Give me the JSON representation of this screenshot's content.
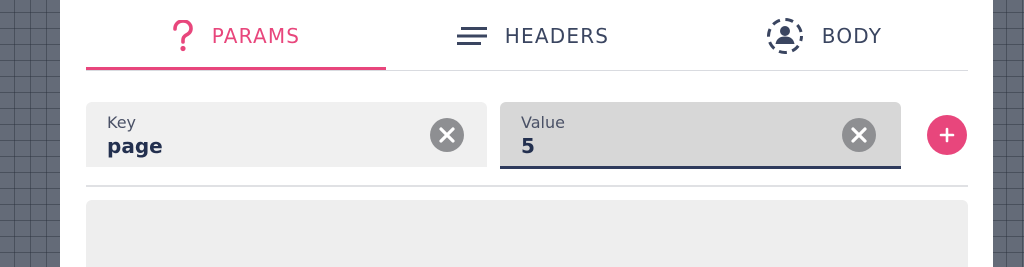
{
  "tabs": [
    {
      "label": "PARAMS",
      "icon": "question-icon",
      "active": true
    },
    {
      "label": "HEADERS",
      "icon": "lines-icon",
      "active": false
    },
    {
      "label": "BODY",
      "icon": "user-circle-icon",
      "active": false
    }
  ],
  "params": {
    "key": {
      "label": "Key",
      "value": "page"
    },
    "value": {
      "label": "Value",
      "value": "5"
    }
  },
  "colors": {
    "accent": "#e8467c",
    "text": "#3a4560",
    "field_value_text": "#23304f"
  }
}
